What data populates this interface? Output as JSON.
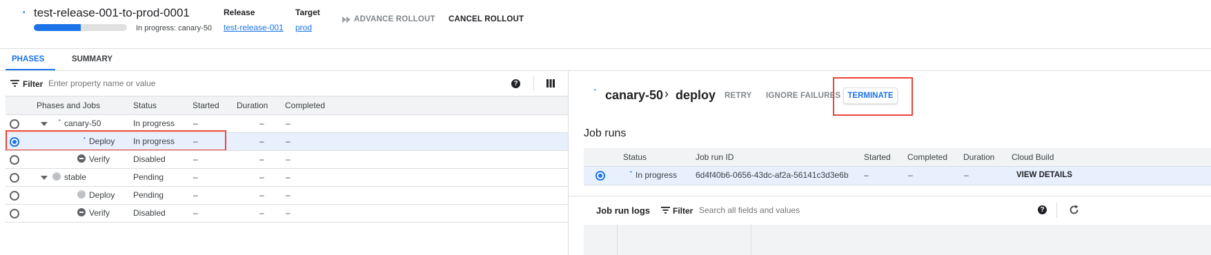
{
  "rollout": {
    "title": "test-release-001-to-prod-0001",
    "progress_fraction": 0.5,
    "status_text": "In progress: canary-50",
    "release_label": "Release",
    "release_link": "test-release-001",
    "target_label": "Target",
    "target_link": "prod",
    "advance_label": "ADVANCE ROLLOUT",
    "cancel_label": "CANCEL ROLLOUT"
  },
  "tabs": [
    {
      "label": "PHASES",
      "active": true
    },
    {
      "label": "SUMMARY",
      "active": false
    }
  ],
  "filter": {
    "label": "Filter",
    "placeholder": "Enter property name or value"
  },
  "phases_table": {
    "columns": [
      "Phases and Jobs",
      "Status",
      "Started",
      "Duration",
      "Completed"
    ],
    "rows": [
      {
        "name": "canary-50",
        "status": "In progress",
        "started": "–",
        "duration": "–",
        "completed": "–",
        "selected": false
      },
      {
        "name": "Deploy",
        "status": "In progress",
        "started": "–",
        "duration": "–",
        "completed": "–",
        "selected": true
      },
      {
        "name": "Verify",
        "status": "Disabled",
        "started": "–",
        "duration": "–",
        "completed": "–",
        "selected": false
      },
      {
        "name": "stable",
        "status": "Pending",
        "started": "–",
        "duration": "–",
        "completed": "–",
        "selected": false
      },
      {
        "name": "Deploy",
        "status": "Pending",
        "started": "–",
        "duration": "–",
        "completed": "–",
        "selected": false
      },
      {
        "name": "Verify",
        "status": "Disabled",
        "started": "–",
        "duration": "–",
        "completed": "–",
        "selected": false
      }
    ]
  },
  "detail": {
    "phase": "canary-50",
    "separator": "›",
    "job": "deploy",
    "retry_label": "RETRY",
    "ignore_label": "IGNORE FAILURES",
    "terminate_label": "TERMINATE",
    "job_runs_title": "Job runs",
    "job_runs_columns": [
      "Status",
      "Job run ID",
      "Started",
      "Completed",
      "Duration",
      "Cloud Build"
    ],
    "job_run": {
      "status": "In progress",
      "id": "6d4f40b6-0656-43dc-af2a-56141c3d3e6b",
      "started": "–",
      "completed": "–",
      "duration": "–",
      "action": "VIEW DETAILS"
    },
    "logs_title": "Job run logs",
    "logs_filter_label": "Filter",
    "logs_filter_placeholder": "Search all fields and values"
  }
}
